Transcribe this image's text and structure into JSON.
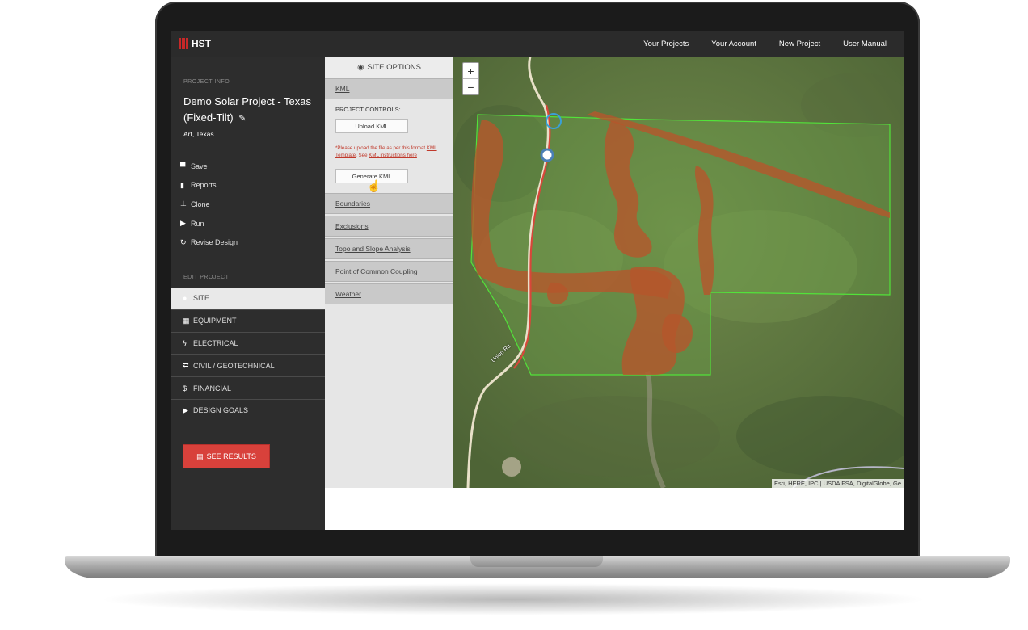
{
  "header": {
    "logo_text": "HST",
    "nav": [
      "Your Projects",
      "Your Account",
      "New Project",
      "User Manual"
    ]
  },
  "sidebar": {
    "project_info_label": "PROJECT INFO",
    "project_title": "Demo Solar Project - Texas (Fixed-Tilt)",
    "project_location": "Art, Texas",
    "actions": [
      {
        "label": "Save",
        "icon": "floppy-icon"
      },
      {
        "label": "Reports",
        "icon": "document-icon"
      },
      {
        "label": "Clone",
        "icon": "stamp-icon"
      },
      {
        "label": "Run",
        "icon": "play-icon"
      },
      {
        "label": "Revise Design",
        "icon": "refresh-icon"
      }
    ],
    "edit_project_label": "EDIT PROJECT",
    "edit_items": [
      {
        "label": "SITE",
        "icon": "globe-icon",
        "active": true
      },
      {
        "label": "EQUIPMENT",
        "icon": "grid-icon"
      },
      {
        "label": "ELECTRICAL",
        "icon": "bolt-icon"
      },
      {
        "label": "CIVIL / GEOTECHNICAL",
        "icon": "exchange-icon"
      },
      {
        "label": "FINANCIAL",
        "icon": "dollar-icon"
      },
      {
        "label": "DESIGN GOALS",
        "icon": "play-icon"
      }
    ],
    "see_results_label": "SEE RESULTS"
  },
  "panel": {
    "title": "SITE OPTIONS",
    "kml_label": "KML",
    "project_controls_label": "PROJECT CONTROLS:",
    "upload_kml_label": "Upload KML",
    "note_prefix": "*Please upload the file as per this format ",
    "note_link1": "KML Template",
    "note_mid": ". See ",
    "note_link2": "KML instructions here",
    "generate_kml_label": "Generate KML",
    "sections": [
      "Boundaries",
      "Exclusions",
      "Topo and Slope Analysis",
      "Point of Common Coupling",
      "Weather"
    ]
  },
  "map": {
    "zoom_in": "+",
    "zoom_out": "−",
    "road_label": "Union Rd",
    "attribution": "Esri, HERE, IPC | USDA FSA, DigitalGlobe, Ge",
    "colors": {
      "boundary": "#52e33a",
      "exclusion": "#b5562c",
      "terrain": "#5d7440"
    }
  }
}
